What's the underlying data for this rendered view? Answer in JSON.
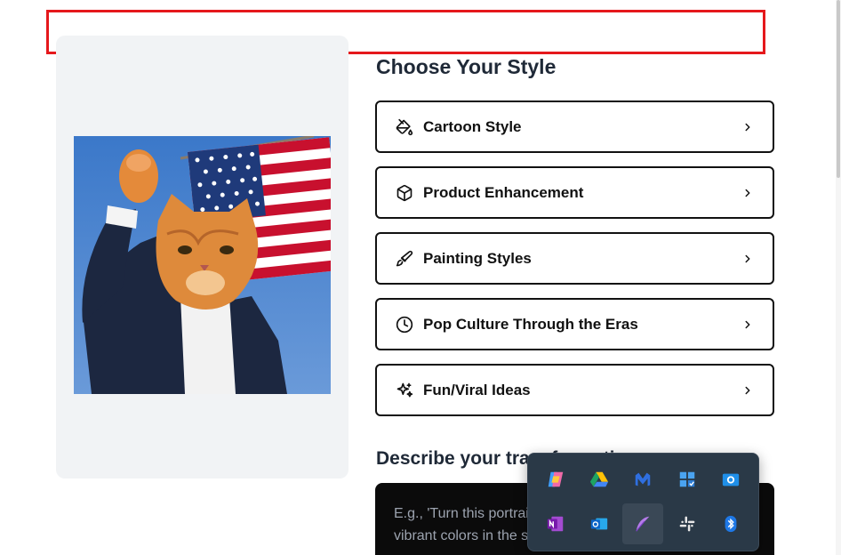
{
  "main": {
    "heading": "Choose Your Style",
    "styles": [
      {
        "label": "Cartoon Style",
        "icon": "paint-bucket-icon"
      },
      {
        "label": "Product Enhancement",
        "icon": "box-icon"
      },
      {
        "label": "Painting Styles",
        "icon": "paintbrush-icon"
      },
      {
        "label": "Pop Culture Through the Eras",
        "icon": "clock-icon"
      },
      {
        "label": "Fun/Viral Ideas",
        "icon": "sparkles-icon"
      }
    ],
    "describe_heading": "Describe your transformation",
    "prompt_placeholder_line1": "E.g., 'Turn this portrait into a",
    "prompt_placeholder_line2": "vibrant colors in the style of..."
  },
  "preview": {
    "image_icon": "cat-portrait-image"
  },
  "tray": {
    "icons": [
      "copilot-icon",
      "google-drive-icon",
      "malwarebytes-icon",
      "task-manager-icon",
      "camera-app-icon",
      "onenote-icon",
      "outlook-icon",
      "feather-app-icon",
      "slack-icon",
      "bluetooth-icon"
    ]
  },
  "colors": {
    "accent_red": "#e5181c",
    "panel_bg": "#f1f3f5",
    "tray_bg": "#2a3947"
  }
}
